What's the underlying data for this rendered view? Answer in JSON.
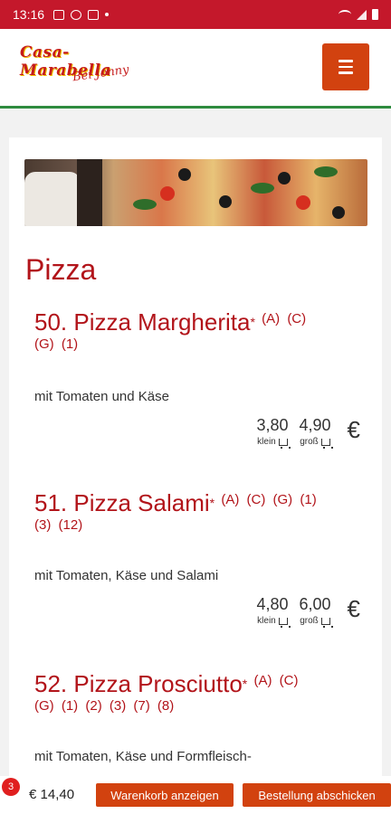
{
  "status": {
    "time": "13:16"
  },
  "header": {
    "logo_line1": "Casa-Marabella",
    "logo_line2": "Bei Jonny"
  },
  "category": {
    "title": "Pizza"
  },
  "items": [
    {
      "name": "50. Pizza Margherita",
      "star": "*",
      "allergens": [
        "(A)",
        "(C)",
        "(G)",
        "(1)"
      ],
      "description": "mit Tomaten und Käse",
      "price_small": "3,80",
      "price_large": "4,90",
      "label_small": "klein",
      "label_large": "groß",
      "currency": "€"
    },
    {
      "name": "51. Pizza Salami",
      "star": "*",
      "allergens": [
        "(A)",
        "(C)",
        "(G)",
        "(1)",
        "(3)",
        "(12)"
      ],
      "description": "mit Tomaten, Käse und Salami",
      "price_small": "4,80",
      "price_large": "6,00",
      "label_small": "klein",
      "label_large": "groß",
      "currency": "€"
    },
    {
      "name": "52. Pizza Prosciutto",
      "star": "*",
      "allergens": [
        "(A)",
        "(C)",
        "(G)",
        "(1)",
        "(2)",
        "(3)",
        "(7)",
        "(8)"
      ],
      "description": "mit Tomaten, Käse und Formfleisch-"
    }
  ],
  "cart": {
    "count": "3",
    "total": "€ 14,40",
    "show_cart_label": "Warenkorb anzeigen",
    "checkout_label": "Bestellung abschicken"
  },
  "colors": {
    "statusbar": "#c4182b",
    "accent": "#d2420f",
    "title_red": "#b2141a",
    "header_line": "#2e8b3f"
  }
}
